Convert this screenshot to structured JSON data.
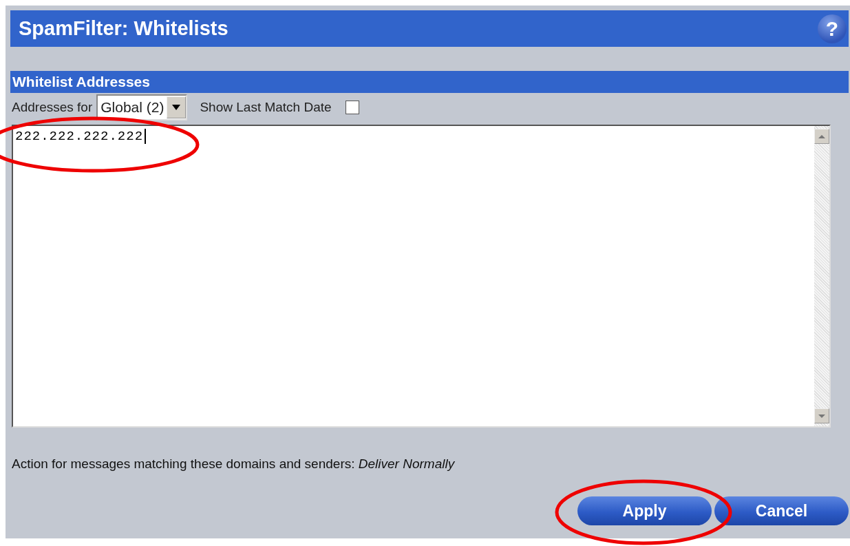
{
  "header": {
    "title": "SpamFilter: Whitelists",
    "help": "?"
  },
  "section": {
    "title": "Whitelist Addresses"
  },
  "filter": {
    "label": "Addresses for",
    "dropdown_value": "Global (2)",
    "checkbox_label": "Show Last Match Date",
    "checked": false
  },
  "addresses": {
    "value": "222.222.222.222"
  },
  "action_text": "Action for messages matching these domains and senders: *Deliver Normally*",
  "buttons": [
    {
      "label": "Apply"
    },
    {
      "label": "Cancel"
    }
  ]
}
